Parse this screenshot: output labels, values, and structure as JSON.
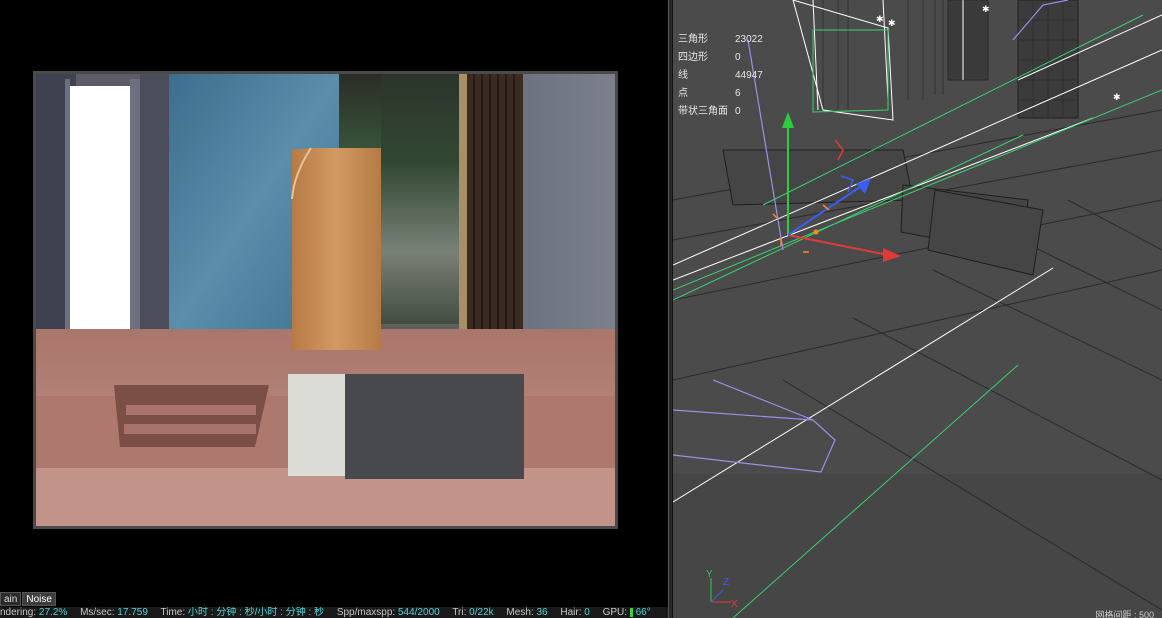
{
  "render_view": {
    "pass_tabs": [
      {
        "label": "ain",
        "active": false
      },
      {
        "label": "Noise",
        "active": true
      }
    ],
    "status": {
      "rendering_label": "ndering:",
      "rendering_value": "27.2%",
      "ms_label": "Ms/sec:",
      "ms_value": "17.759",
      "time_label": "Time:",
      "time_value": "小时 : 分钟 : 秒/小时 : 分钟 : 秒",
      "spp_label": "Spp/maxspp:",
      "spp_value": "544/2000",
      "tri_label": "Tri:",
      "tri_value": "0/22k",
      "mesh_label": "Mesh:",
      "mesh_value": "36",
      "hair_label": "Hair:",
      "hair_value": "0",
      "gpu_label": "GPU:",
      "gpu_value": "66°"
    }
  },
  "viewport": {
    "stats": [
      {
        "label": "三角形",
        "value": "23022"
      },
      {
        "label": "四边形",
        "value": "0"
      },
      {
        "label": "线",
        "value": "44947"
      },
      {
        "label": "点",
        "value": "6"
      },
      {
        "label": "带状三角面",
        "value": "0"
      }
    ],
    "axis_labels": {
      "y": "Y",
      "z": "Z",
      "x": "X"
    },
    "bottom_note": "网格间距 : 500"
  },
  "colors": {
    "status_value": "#4fd3d9",
    "viewport_bg": "#4b4b4b",
    "floor_pink": "#b9857a",
    "wall_blue": "#4f7f9c",
    "wood": "#c98d55",
    "axis_x": "#e23a3a",
    "axis_y": "#2ecc40",
    "axis_z": "#3a5ef0",
    "selection_green": "#3bd16f",
    "camera_lilac": "#9b8fe8"
  }
}
